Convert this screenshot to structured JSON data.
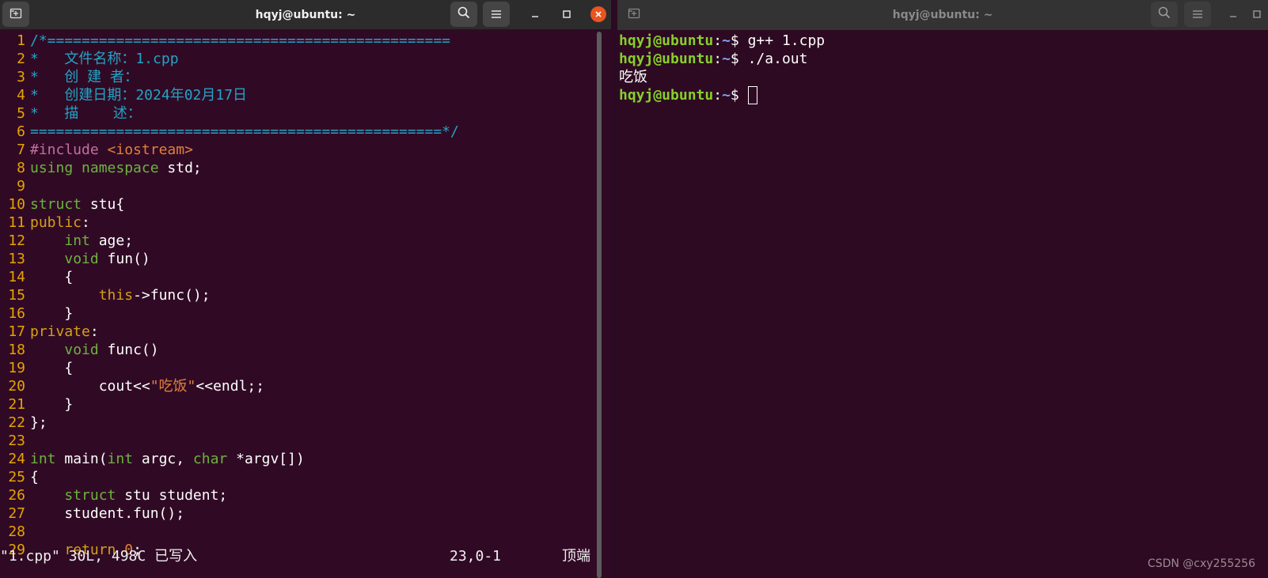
{
  "colors": {
    "terminal_bg": "#300a24",
    "line_number": "#e6a400",
    "comment": "#23a3c6",
    "keyword": "#6db33f",
    "preproc": "#c070a0",
    "string": "#e0803a",
    "accent_keyword": "#d4a017",
    "prompt_user": "#87d02a",
    "prompt_path": "#7aa0f0",
    "close_button": "#e95420"
  },
  "left_window": {
    "title": "hqyj@ubuntu: ~",
    "icons": {
      "new_tab": "new-tab-icon",
      "search": "search-icon",
      "menu": "hamburger-menu-icon",
      "minimize": "minimize-icon",
      "maximize": "maximize-icon",
      "close": "close-icon"
    },
    "editor": {
      "lines": [
        {
          "n": "1",
          "text": "/*==============================================="
        },
        {
          "n": "2",
          "text": "*   文件名称：1.cpp"
        },
        {
          "n": "3",
          "text": "*   创 建 者："
        },
        {
          "n": "4",
          "text": "*   创建日期：2024年02月17日"
        },
        {
          "n": "5",
          "text": "*   描    述："
        },
        {
          "n": "6",
          "text": "================================================*/"
        },
        {
          "n": "7",
          "text": "#include <iostream>"
        },
        {
          "n": "8",
          "text": "using namespace std;"
        },
        {
          "n": "9",
          "text": ""
        },
        {
          "n": "10",
          "text": "struct stu{"
        },
        {
          "n": "11",
          "text": "public:"
        },
        {
          "n": "12",
          "text": "    int age;"
        },
        {
          "n": "13",
          "text": "    void fun()"
        },
        {
          "n": "14",
          "text": "    {"
        },
        {
          "n": "15",
          "text": "        this->func();"
        },
        {
          "n": "16",
          "text": "    }"
        },
        {
          "n": "17",
          "text": "private:"
        },
        {
          "n": "18",
          "text": "    void func()"
        },
        {
          "n": "19",
          "text": "    {"
        },
        {
          "n": "20",
          "text": "        cout<<\"吃饭\"<<endl;;"
        },
        {
          "n": "21",
          "text": "    }"
        },
        {
          "n": "22",
          "text": "};"
        },
        {
          "n": "23",
          "text": ""
        },
        {
          "n": "24",
          "text": "int main(int argc, char *argv[])"
        },
        {
          "n": "25",
          "text": "{"
        },
        {
          "n": "26",
          "text": "    struct stu student;"
        },
        {
          "n": "27",
          "text": "    student.fun();"
        },
        {
          "n": "28",
          "text": ""
        },
        {
          "n": "29",
          "text": "    return 0;"
        }
      ]
    },
    "statusbar": {
      "file_info": "\"1.cpp\" 30L, 498C 已写入",
      "position": "23,0-1",
      "scroll": "顶端"
    }
  },
  "right_window": {
    "title": "hqyj@ubuntu: ~",
    "icons": {
      "new_tab": "new-tab-icon",
      "search": "search-icon",
      "menu": "hamburger-menu-icon",
      "minimize": "minimize-icon",
      "maximize": "maximize-icon"
    },
    "prompt_user": "hqyj@ubuntu",
    "prompt_sep": ":",
    "prompt_path": "~",
    "prompt_symbol": "$ ",
    "lines": [
      {
        "type": "cmd",
        "command": "g++ 1.cpp"
      },
      {
        "type": "cmd",
        "command": "./a.out"
      },
      {
        "type": "out",
        "text": "吃饭"
      },
      {
        "type": "cursor",
        "command": ""
      }
    ]
  },
  "watermark": "CSDN @cxy255256"
}
